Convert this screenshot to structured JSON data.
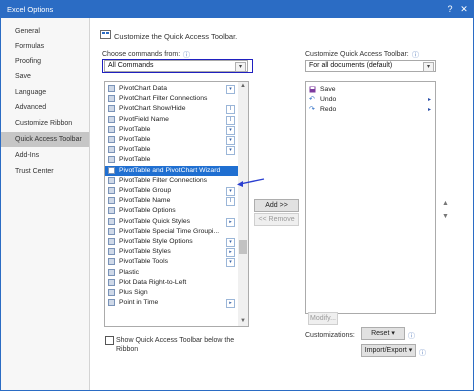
{
  "window": {
    "title": "Excel Options"
  },
  "sidebar": {
    "items": [
      "General",
      "Formulas",
      "Proofing",
      "Save",
      "Language",
      "Advanced",
      "Customize Ribbon",
      "Quick Access Toolbar",
      "Add-Ins",
      "Trust Center"
    ],
    "active": "Quick Access Toolbar"
  },
  "main": {
    "heading": "Customize the Quick Access Toolbar.",
    "choose_label": "Choose commands from:",
    "choose_value": "All Commands",
    "customize_label": "Customize Quick Access Toolbar:",
    "customize_value": "For all documents (default)"
  },
  "commands": [
    {
      "label": "PivotChart Data",
      "mark": "▾"
    },
    {
      "label": "PivotChart Filter Connections",
      "mark": ""
    },
    {
      "label": "PivotChart Show/Hide",
      "mark": "I"
    },
    {
      "label": "PivotField Name",
      "mark": "I"
    },
    {
      "label": "PivotTable",
      "mark": "▾"
    },
    {
      "label": "PivotTable",
      "mark": "▾"
    },
    {
      "label": "PivotTable",
      "mark": "▾"
    },
    {
      "label": "PivotTable",
      "mark": ""
    },
    {
      "label": "PivotTable and PivotChart Wizard",
      "mark": ""
    },
    {
      "label": "PivotTable Filter Connections",
      "mark": ""
    },
    {
      "label": "PivotTable Group",
      "mark": "▾"
    },
    {
      "label": "PivotTable Name",
      "mark": "I"
    },
    {
      "label": "PivotTable Options",
      "mark": ""
    },
    {
      "label": "PivotTable Quick Styles",
      "mark": "▸"
    },
    {
      "label": "PivotTable Special Time Groupi...",
      "mark": ""
    },
    {
      "label": "PivotTable Style Options",
      "mark": "▾"
    },
    {
      "label": "PivotTable Styles",
      "mark": "▸"
    },
    {
      "label": "PivotTable Tools",
      "mark": "▾"
    },
    {
      "label": "Plastic",
      "mark": ""
    },
    {
      "label": "Plot Data Right-to-Left",
      "mark": ""
    },
    {
      "label": "Plus Sign",
      "mark": ""
    },
    {
      "label": "Point in Time",
      "mark": "▸"
    }
  ],
  "selected_command": "PivotTable and PivotChart Wizard",
  "toolbar_items": [
    "Save",
    "Undo",
    "Redo"
  ],
  "buttons": {
    "add": "Add >>",
    "remove": "<< Remove",
    "modify": "Modify...",
    "reset": "Reset",
    "import_export": "Import/Export"
  },
  "customizations_label": "Customizations:",
  "show_below": {
    "line1": "Show Quick Access Toolbar below the",
    "line2": "Ribbon",
    "checked": false
  },
  "colors": {
    "title_bar": "#2b6cc4",
    "selection": "#1f6fd1",
    "highlight_box": "#2020c0",
    "arrow": "#2a3fd0"
  }
}
